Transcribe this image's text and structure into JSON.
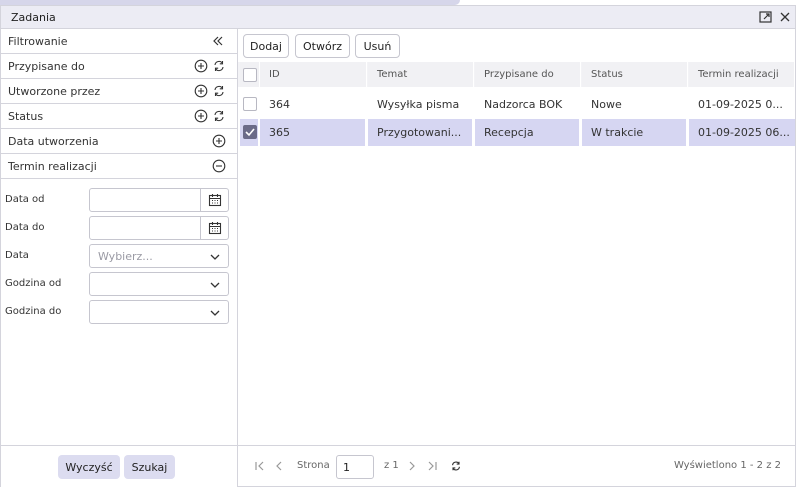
{
  "window": {
    "title": "Zadania"
  },
  "sidebar": {
    "header_label": "Filtrowanie",
    "sections": [
      {
        "label": "Przypisane do"
      },
      {
        "label": "Utworzone przez"
      },
      {
        "label": "Status"
      },
      {
        "label": "Data utworzenia"
      },
      {
        "label": "Termin realizacji"
      }
    ],
    "fields": {
      "date_from": {
        "label": "Data od",
        "value": ""
      },
      "date_to": {
        "label": "Data do",
        "value": ""
      },
      "date": {
        "label": "Data",
        "placeholder": "Wybierz..."
      },
      "hour_from": {
        "label": "Godzina od",
        "value": ""
      },
      "hour_to": {
        "label": "Godzina do",
        "value": ""
      }
    },
    "clear_label": "Wyczyść",
    "search_label": "Szukaj"
  },
  "toolbar": {
    "add_label": "Dodaj",
    "open_label": "Otwórz",
    "delete_label": "Usuń"
  },
  "table": {
    "columns": [
      "ID",
      "Temat",
      "Przypisane do",
      "Status",
      "Termin realizacji"
    ],
    "rows": [
      {
        "selected": false,
        "id": "364",
        "topic": "Wysyłka pisma",
        "assigned": "Nadzorca BOK",
        "status": "Nowe",
        "due": "01-09-2025 0..."
      },
      {
        "selected": true,
        "id": "365",
        "topic": "Przygotowani...",
        "assigned": "Recepcja",
        "status": "W trakcie",
        "due": "01-09-2025 06..."
      }
    ]
  },
  "pager": {
    "page_label": "Strona",
    "page_value": "1",
    "of_label": "z 1",
    "summary": "Wyświetlono 1 - 2 z 2"
  },
  "colors": {
    "accent": "#6b6b88",
    "selection": "#d6d6f2",
    "soft_button": "#dcdcf0"
  }
}
